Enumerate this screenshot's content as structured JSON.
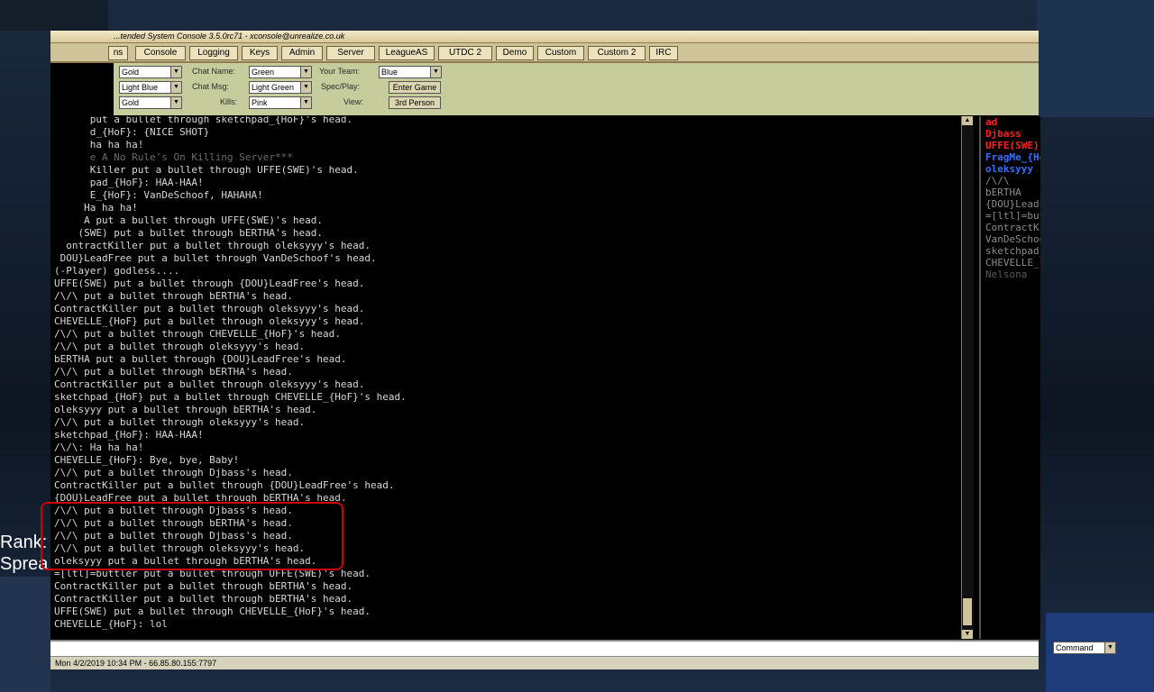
{
  "window": {
    "title": "...tended System Console 3.5.0rc71 - xconsole@unrealize.co.uk",
    "tabs": [
      "ns",
      "Console",
      "Logging",
      "Keys",
      "Admin",
      "Server",
      "LeagueAS",
      "UTDC 2",
      "Demo",
      "Custom",
      "Custom 2",
      "IRC"
    ]
  },
  "options": {
    "left_dropdowns": [
      "Gold",
      "Light Blue",
      "Gold"
    ],
    "chat_name_label": "Chat Name:",
    "chat_name_value": "Green",
    "chat_msg_label": "Chat   Msg:",
    "chat_msg_value": "Light Green",
    "kills_label": "Kills:",
    "kills_value": "Pink",
    "your_team_label": "Your Team:",
    "your_team_value": "Blue",
    "spec_play_label": "Spec/Play:",
    "enter_game_button": "Enter Game",
    "view_label": "View:",
    "view_button": "3rd Person"
  },
  "log_lines": [
    {
      "text": "      put a bullet through sketchpad_{HoF}'s head.",
      "dim": false
    },
    {
      "text": "      d_{HoF}: {NICE SHOT}",
      "dim": false
    },
    {
      "text": "      ha ha ha!",
      "dim": false
    },
    {
      "text": "      e A No Rule's On Killing Server***",
      "dim": true
    },
    {
      "text": "      Killer put a bullet through UFFE(SWE)'s head.",
      "dim": false
    },
    {
      "text": "      pad_{HoF}: HAA-HAA!",
      "dim": false
    },
    {
      "text": "      E_{HoF}: VanDeSchoof, HAHAHA!",
      "dim": false
    },
    {
      "text": "     Ha ha ha!",
      "dim": false
    },
    {
      "text": "     A put a bullet through UFFE(SWE)'s head.",
      "dim": false
    },
    {
      "text": "    (SWE) put a bullet through bERTHA's head.",
      "dim": false
    },
    {
      "text": "  ontractKiller put a bullet through oleksyyy's head.",
      "dim": false
    },
    {
      "text": " DOU}LeadFree put a bullet through VanDeSchoof's head.",
      "dim": false
    },
    {
      "text": "(-Player) godless....",
      "dim": false
    },
    {
      "text": "UFFE(SWE) put a bullet through {DOU}LeadFree's head.",
      "dim": false
    },
    {
      "text": "/\\/\\ put a bullet through bERTHA's head.",
      "dim": false
    },
    {
      "text": "ContractKiller put a bullet through oleksyyy's head.",
      "dim": false
    },
    {
      "text": "CHEVELLE_{HoF} put a bullet through oleksyyy's head.",
      "dim": false
    },
    {
      "text": "/\\/\\ put a bullet through CHEVELLE_{HoF}'s head.",
      "dim": false
    },
    {
      "text": "/\\/\\ put a bullet through oleksyyy's head.",
      "dim": false
    },
    {
      "text": "bERTHA put a bullet through {DOU}LeadFree's head.",
      "dim": false
    },
    {
      "text": "/\\/\\ put a bullet through bERTHA's head.",
      "dim": false
    },
    {
      "text": "ContractKiller put a bullet through oleksyyy's head.",
      "dim": false
    },
    {
      "text": "sketchpad_{HoF} put a bullet through CHEVELLE_{HoF}'s head.",
      "dim": false
    },
    {
      "text": "oleksyyy put a bullet through bERTHA's head.",
      "dim": false
    },
    {
      "text": "/\\/\\ put a bullet through oleksyyy's head.",
      "dim": false
    },
    {
      "text": "sketchpad_{HoF}: HAA-HAA!",
      "dim": false
    },
    {
      "text": "/\\/\\: Ha ha ha!",
      "dim": false
    },
    {
      "text": "CHEVELLE_{HoF}: Bye, bye, Baby!",
      "dim": false
    },
    {
      "text": "/\\/\\ put a bullet through Djbass's head.",
      "dim": false
    },
    {
      "text": "ContractKiller put a bullet through {DOU}LeadFree's head.",
      "dim": false
    },
    {
      "text": "{DOU}LeadFree put a bullet through bERTHA's head.",
      "dim": false
    },
    {
      "text": "/\\/\\ put a bullet through Djbass's head.",
      "dim": false
    },
    {
      "text": "/\\/\\ put a bullet through bERTHA's head.",
      "dim": false
    },
    {
      "text": "/\\/\\ put a bullet through Djbass's head.",
      "dim": false
    },
    {
      "text": "/\\/\\ put a bullet through oleksyyy's head.",
      "dim": false
    },
    {
      "text": "oleksyyy put a bullet through bERTHA's head.",
      "dim": false
    },
    {
      "text": "=[ltl]=buttler put a bullet through UFFE(SWE)'s head.",
      "dim": false
    },
    {
      "text": "ContractKiller put a bullet through bERTHA's head.",
      "dim": false
    },
    {
      "text": "ContractKiller put a bullet through bERTHA's head.",
      "dim": false
    },
    {
      "text": "UFFE(SWE) put a bullet through CHEVELLE_{HoF}'s head.",
      "dim": false
    },
    {
      "text": "CHEVELLE_{HoF}: lol",
      "dim": false
    }
  ],
  "players": [
    {
      "name": "ad",
      "color": "#ff2020",
      "bold": true
    },
    {
      "name": "Djbass",
      "color": "#ff2020",
      "bold": true
    },
    {
      "name": "UFFE(SWE)",
      "color": "#ff2020",
      "bold": true
    },
    {
      "name": "FragMe_{HoF}",
      "color": "#3a6fff",
      "bold": true
    },
    {
      "name": "oleksyyy",
      "color": "#3a6fff",
      "bold": true
    },
    {
      "name": "/\\/\\",
      "color": "#8c8c8c",
      "bold": false
    },
    {
      "name": "bERTHA",
      "color": "#8c8c8c",
      "bold": false
    },
    {
      "name": "{DOU}LeadFree",
      "color": "#8c8c8c",
      "bold": false
    },
    {
      "name": "=[ltl]=buttler",
      "color": "#8c8c8c",
      "bold": false
    },
    {
      "name": "ContractKiller",
      "color": "#8c8c8c",
      "bold": false
    },
    {
      "name": "VanDeSchoof",
      "color": "#8c8c8c",
      "bold": false
    },
    {
      "name": "sketchpad_{HoF}",
      "color": "#8c8c8c",
      "bold": false
    },
    {
      "name": "CHEVELLE_{HoF}",
      "color": "#8c8c8c",
      "bold": false
    },
    {
      "name": "Nelsona",
      "color": "#5a5a5a",
      "bold": false
    }
  ],
  "command": {
    "mode": "Command",
    "value": ""
  },
  "status": "Mon 4/2/2019 10:34 PM - 66.85.80.155:7797",
  "hud": {
    "rank": "Rank:",
    "spread": "Sprea"
  }
}
